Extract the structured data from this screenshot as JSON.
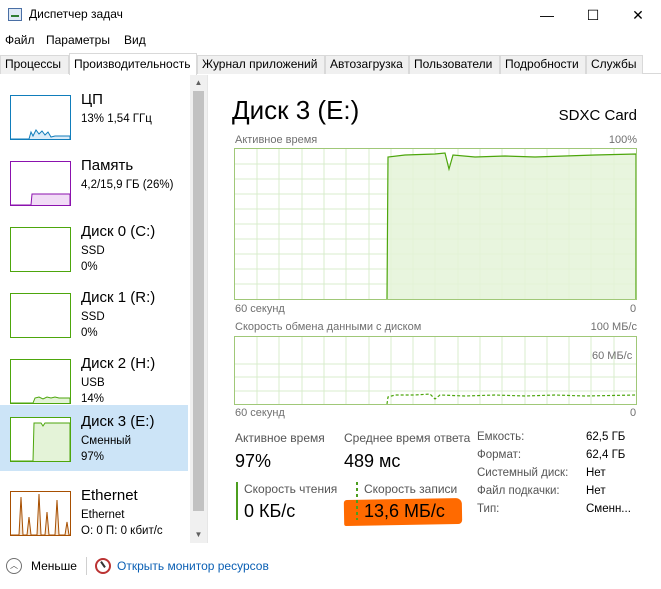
{
  "window": {
    "title": "Диспетчер задач",
    "minimize": "—",
    "maximize": "☐",
    "close": "✕"
  },
  "menu": [
    "Файл",
    "Параметры",
    "Вид"
  ],
  "tabs": [
    "Процессы",
    "Производительность",
    "Журнал приложений",
    "Автозагрузка",
    "Пользователи",
    "Подробности",
    "Службы"
  ],
  "sidebar": {
    "items": [
      {
        "title": "ЦП",
        "sub1": "13%  1,54 ГГц",
        "sub2": ""
      },
      {
        "title": "Память",
        "sub1": "4,2/15,9 ГБ (26%)",
        "sub2": ""
      },
      {
        "title": "Диск 0 (C:)",
        "sub1": "SSD",
        "sub2": "0%"
      },
      {
        "title": "Диск 1 (R:)",
        "sub1": "SSD",
        "sub2": "0%"
      },
      {
        "title": "Диск 2 (H:)",
        "sub1": "USB",
        "sub2": "14%"
      },
      {
        "title": "Диск 3 (E:)",
        "sub1": "Сменный",
        "sub2": "97%"
      },
      {
        "title": "Ethernet",
        "sub1": "Ethernet",
        "sub2": "О: 0 П: 0 кбит/с"
      }
    ],
    "colors": {
      "cpu": "#117dbb",
      "memory": "#8b12ae",
      "disk": "#4da60c",
      "ethernet": "#a74f01",
      "selected": "#cce4f7"
    }
  },
  "main": {
    "title": "Диск 3 (E:)",
    "model": "SDXC Card",
    "graph1": {
      "label": "Активное время",
      "max": "100%",
      "time": "60 секунд",
      "min": "0"
    },
    "graph2": {
      "label": "Скорость обмена данными с диском",
      "max": "100 МБ/с",
      "mid": "60 МБ/с",
      "time": "60 секунд",
      "min": "0"
    },
    "stats": {
      "active_label": "Активное время",
      "active_value": "97%",
      "response_label": "Среднее время ответа",
      "response_value": "489 мс",
      "read_label": "Скорость чтения",
      "read_value": "0 КБ/с",
      "write_label": "Скорость записи",
      "write_value": "13,6 МБ/с"
    },
    "props": [
      {
        "label": "Емкость:",
        "value": "62,5 ГБ"
      },
      {
        "label": "Формат:",
        "value": "62,4 ГБ"
      },
      {
        "label": "Системный диск:",
        "value": "Нет"
      },
      {
        "label": "Файл подкачки:",
        "value": "Нет"
      },
      {
        "label": "Тип:",
        "value": "Сменн..."
      }
    ],
    "highlight_color": "#ff6a00"
  },
  "footer": {
    "fewer": "Меньше",
    "monitor": "Открыть монитор ресурсов"
  }
}
